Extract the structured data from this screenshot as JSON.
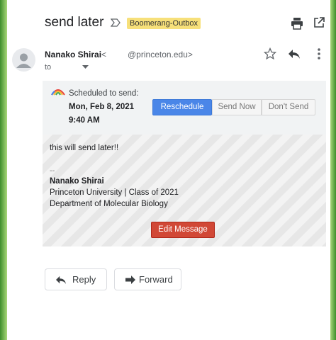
{
  "header": {
    "subject": "send later",
    "label": "Boomerang-Outbox"
  },
  "sender": {
    "name": "Nanako Shirai",
    "lt": "<",
    "email": "@princeton.edu>",
    "to": "to"
  },
  "boomerang": {
    "scheduled_prefix": "Scheduled to send:",
    "scheduled_time": "Mon, Feb 8, 2021 9:40 AM",
    "reschedule_label": "Reschedule",
    "send_now_label": "Send Now",
    "dont_send_label": "Don't Send"
  },
  "message": {
    "body": "this will send later!!",
    "sig_dash": "--",
    "sig_name": "Nanako Shirai",
    "sig_line2": "Princeton University | Class of 2021",
    "sig_line3": "Department of Molecular Biology",
    "edit_label": "Edit Message"
  },
  "actions": {
    "reply_label": "Reply",
    "forward_label": "Forward"
  },
  "colors": {
    "accent_blue": "#4a86e8",
    "edit_red": "#d14836",
    "label_yellow": "#f7e07a"
  }
}
